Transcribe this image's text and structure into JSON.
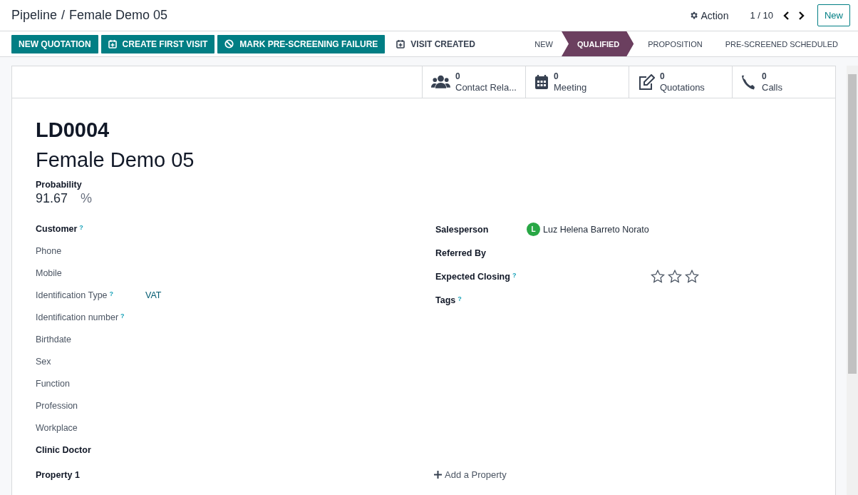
{
  "breadcrumb": {
    "parent": "Pipeline",
    "separator": "/",
    "current": "Female Demo 05"
  },
  "control_panel": {
    "action": "Action",
    "pager": "1 / 10",
    "new_button": "New"
  },
  "status_buttons": [
    {
      "label": "NEW QUOTATION",
      "kind": "primary"
    },
    {
      "label": "CREATE FIRST VISIT",
      "kind": "primary"
    },
    {
      "label": "MARK PRE-SCREENING FAILURE",
      "kind": "primary"
    },
    {
      "label": "VISIT CREATED",
      "kind": "plain"
    }
  ],
  "stages": [
    {
      "label": "NEW",
      "selected": false
    },
    {
      "label": "QUALIFIED",
      "selected": true
    },
    {
      "label": "PROPOSITION",
      "selected": false
    },
    {
      "label": "PRE-SCREENED SCHEDULED",
      "selected": false
    }
  ],
  "smart_buttons": [
    {
      "count": "0",
      "label": "Contact Rela..."
    },
    {
      "count": "0",
      "label": "Meeting"
    },
    {
      "count": "0",
      "label": "Quotations"
    },
    {
      "count": "0",
      "label": "Calls"
    }
  ],
  "record": {
    "reference": "LD0004",
    "name": "Female Demo 05",
    "probability_label": "Probability",
    "probability": "91.67",
    "unit": "%"
  },
  "left_fields": [
    {
      "label": "Customer",
      "strong": true,
      "help": "?"
    },
    {
      "label": "Phone",
      "strong": false
    },
    {
      "label": "Mobile",
      "strong": false
    },
    {
      "label": "Identification Type",
      "strong": false,
      "help": "?",
      "value": "VAT"
    },
    {
      "label": "Identification number",
      "strong": false,
      "help": "?"
    },
    {
      "label": "Birthdate",
      "strong": false
    },
    {
      "label": "Sex",
      "strong": false
    },
    {
      "label": "Function",
      "strong": false
    },
    {
      "label": "Profession",
      "strong": false
    },
    {
      "label": "Workplace",
      "strong": false
    },
    {
      "label": "Clinic Doctor",
      "strong": true
    }
  ],
  "right_fields": [
    {
      "label": "Salesperson",
      "kind": "user",
      "avatar": "L",
      "color": "#28a745",
      "value": "Luz Helena Barreto Norato"
    },
    {
      "label": "Referred By",
      "kind": "text"
    },
    {
      "label": "Expected Closing",
      "kind": "priority",
      "help": "?",
      "stars": 0
    },
    {
      "label": "Tags",
      "kind": "text",
      "help": "?"
    }
  ],
  "properties": {
    "label": "Property 1",
    "add": "Add a Property"
  }
}
